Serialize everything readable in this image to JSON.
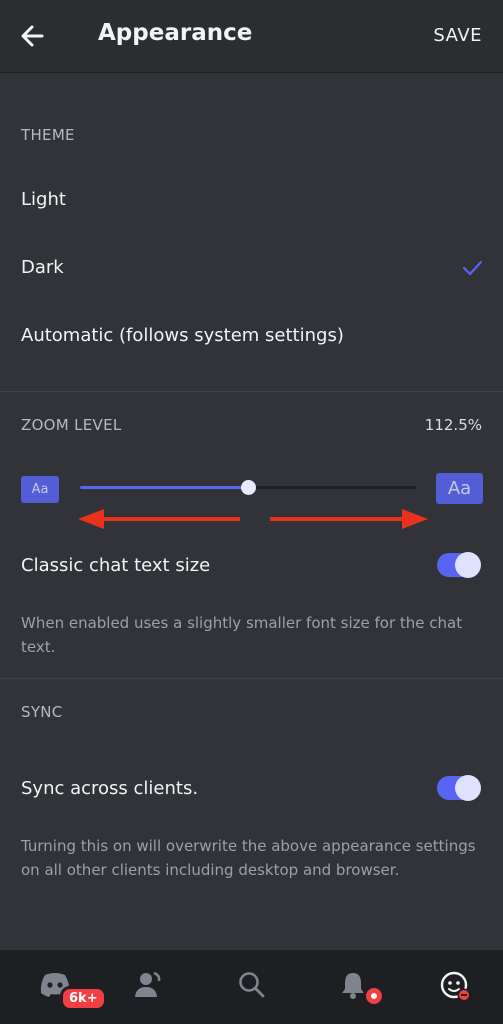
{
  "header": {
    "title": "Appearance",
    "save_label": "SAVE"
  },
  "theme": {
    "section_label": "THEME",
    "options": [
      {
        "label": "Light",
        "selected": false
      },
      {
        "label": "Dark",
        "selected": true
      },
      {
        "label": "Automatic (follows system settings)",
        "selected": false
      }
    ]
  },
  "zoom": {
    "section_label": "ZOOM LEVEL",
    "value_text": "112.5%",
    "small_label": "Aa",
    "large_label": "Aa",
    "slider_fraction": 0.5
  },
  "classic_chat": {
    "label": "Classic chat text size",
    "enabled": true,
    "help": "When enabled uses a slightly smaller font size for the chat text."
  },
  "sync": {
    "section_label": "SYNC",
    "label": "Sync across clients.",
    "enabled": true,
    "help": "Turning this on will overwrite the above appearance settings on all other clients including desktop and browser."
  },
  "bottom_nav": {
    "items": [
      {
        "icon": "discord-home-icon",
        "badge": "6k+"
      },
      {
        "icon": "friends-icon"
      },
      {
        "icon": "search-icon"
      },
      {
        "icon": "bell-icon",
        "dot": true
      },
      {
        "icon": "profile-avatar-icon",
        "status": "do-not-disturb"
      }
    ]
  },
  "colors": {
    "accent": "#5865f2",
    "background": "#313338",
    "nav_background": "#1e1f22",
    "annotation_arrow": "#e8321c",
    "badge": "#f23f43"
  }
}
